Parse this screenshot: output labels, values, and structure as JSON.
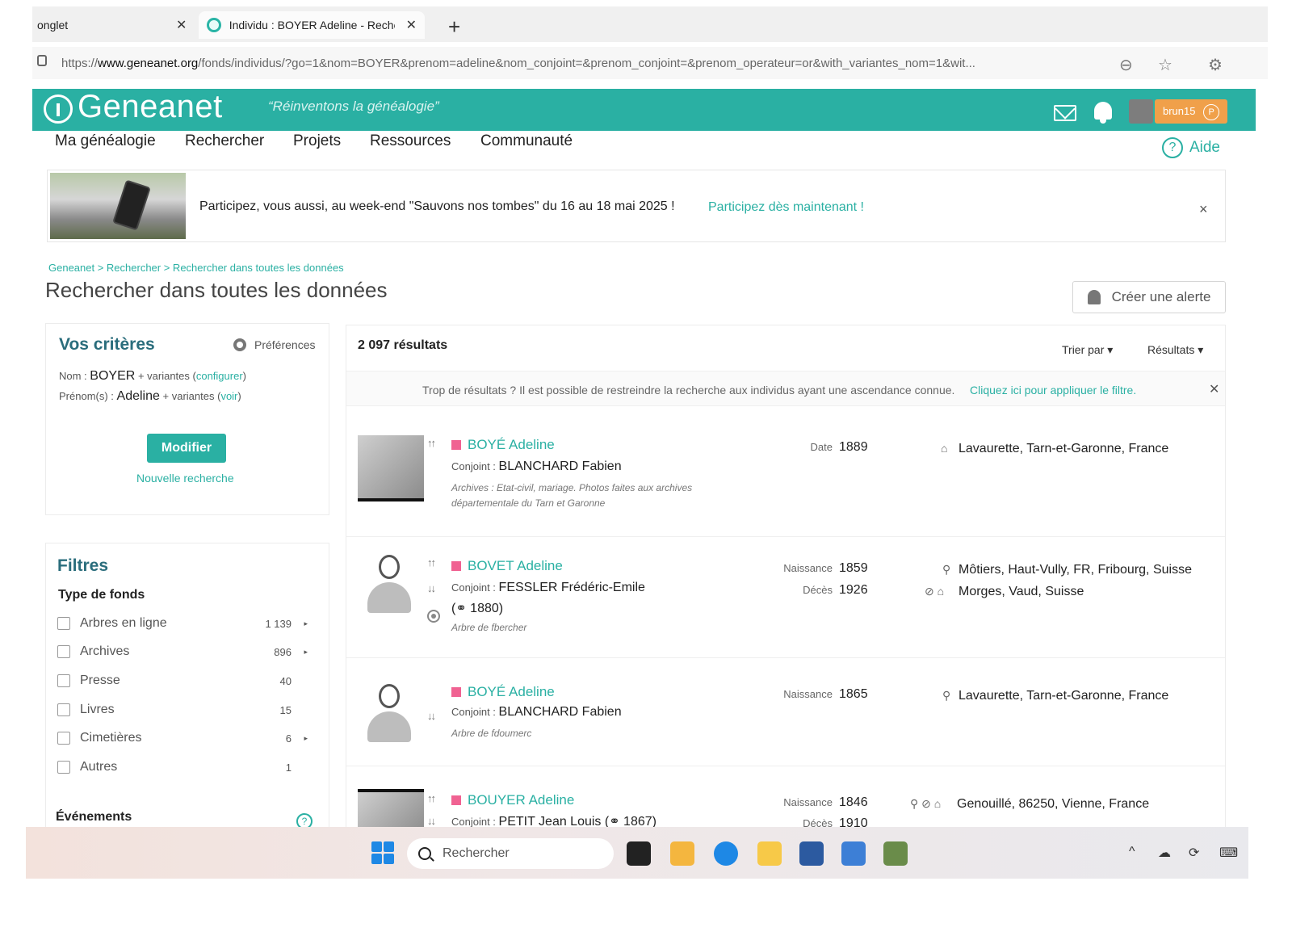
{
  "browser": {
    "tabs": [
      {
        "title": "onglet"
      },
      {
        "title": "Individu : BOYER Adeline - Reche"
      }
    ],
    "new_tab": "+",
    "url_prefix": "https://",
    "url_domain": "www.geneanet.org",
    "url_path": "/fonds/individus/?go=1&nom=BOYER&prenom=adeline&nom_conjoint=&prenom_conjoint=&prenom_operateur=or&with_variantes_nom=1&wit..."
  },
  "header": {
    "logo": "Geneanet",
    "slogan": "“Réinventons la généalogie”",
    "username": "brun15",
    "user_badge_icon": "P"
  },
  "nav": {
    "items": [
      "Ma généalogie",
      "Rechercher",
      "Projets",
      "Ressources",
      "Communauté"
    ],
    "help": "Aide"
  },
  "banner": {
    "text": "Participez, vous aussi, au week-end \"Sauvons nos tombes\" du 16 au 18 mai 2025 !",
    "link": "Participez dès maintenant !",
    "close": "×"
  },
  "page": {
    "breadcrumb": "Geneanet > Rechercher > Rechercher dans toutes les données",
    "title": "Rechercher dans toutes les données",
    "alert_button": "Créer une alerte"
  },
  "criteria": {
    "title": "Vos critères",
    "preferences": "Préférences",
    "nom_label": "Nom :",
    "nom_value": "BOYER",
    "nom_variants": "+ variantes",
    "nom_link": "configurer",
    "prenom_label": "Prénom(s) :",
    "prenom_value": "Adeline",
    "prenom_variants": "+ variantes",
    "prenom_link": "voir",
    "modify": "Modifier",
    "new_search": "Nouvelle recherche"
  },
  "filters": {
    "title": "Filtres",
    "type_title": "Type de fonds",
    "items": [
      {
        "label": "Arbres en ligne",
        "count": "1 139",
        "arrow": "▸"
      },
      {
        "label": "Archives",
        "count": "896",
        "arrow": "▸"
      },
      {
        "label": "Presse",
        "count": "40",
        "arrow": ""
      },
      {
        "label": "Livres",
        "count": "15",
        "arrow": ""
      },
      {
        "label": "Cimetières",
        "count": "6",
        "arrow": "▸"
      },
      {
        "label": "Autres",
        "count": "1",
        "arrow": ""
      }
    ],
    "events_title": "Événements"
  },
  "results": {
    "count": "2 097 résultats",
    "sort": "Trier par ▾",
    "results_dropdown": "Résultats ▾",
    "notice_text": "Trop de résultats ? Il est possible de restreindre la recherche aux individus ayant une ascendance connue.",
    "notice_link": "Cliquez ici pour appliquer le filtre.",
    "records": [
      {
        "name": "BOYÉ Adeline",
        "spouse_label": "Conjoint :",
        "spouse": "BLANCHARD Fabien",
        "source": "Archives : Etat-civil, mariage. Photos faites aux archives départementale du Tarn et Garonne",
        "label1": "Date",
        "year1": "1889",
        "place1": "Lavaurette, Tarn-et-Garonne, France"
      },
      {
        "name": "BOVET Adeline",
        "spouse_label": "Conjoint :",
        "spouse": "FESSLER Frédéric-Emile",
        "spouse_year": "(⚭ 1880)",
        "source": "Arbre de fbercher",
        "label1": "Naissance",
        "year1": "1859",
        "label2": "Décès",
        "year2": "1926",
        "place1": "Môtiers, Haut-Vully, FR, Fribourg, Suisse",
        "place2": "Morges, Vaud, Suisse"
      },
      {
        "name": "BOYÉ Adeline",
        "spouse_label": "Conjoint :",
        "spouse": "BLANCHARD Fabien",
        "source": "Arbre de fdoumerc",
        "label1": "Naissance",
        "year1": "1865",
        "place1": "Lavaurette, Tarn-et-Garonne, France"
      },
      {
        "name": "BOUYER Adeline",
        "spouse_label": "Conjoint :",
        "spouse": "PETIT Jean Louis (⚭ 1867)",
        "label1": "Naissance",
        "year1": "1846",
        "label2": "Décès",
        "year2": "1910",
        "place1": "Genouillé, 86250, Vienne, France"
      }
    ]
  },
  "taskbar": {
    "search_placeholder": "Rechercher"
  },
  "colors": {
    "brand": "#2ab0a3",
    "female": "#f06292",
    "user_badge": "#f0a04a"
  }
}
